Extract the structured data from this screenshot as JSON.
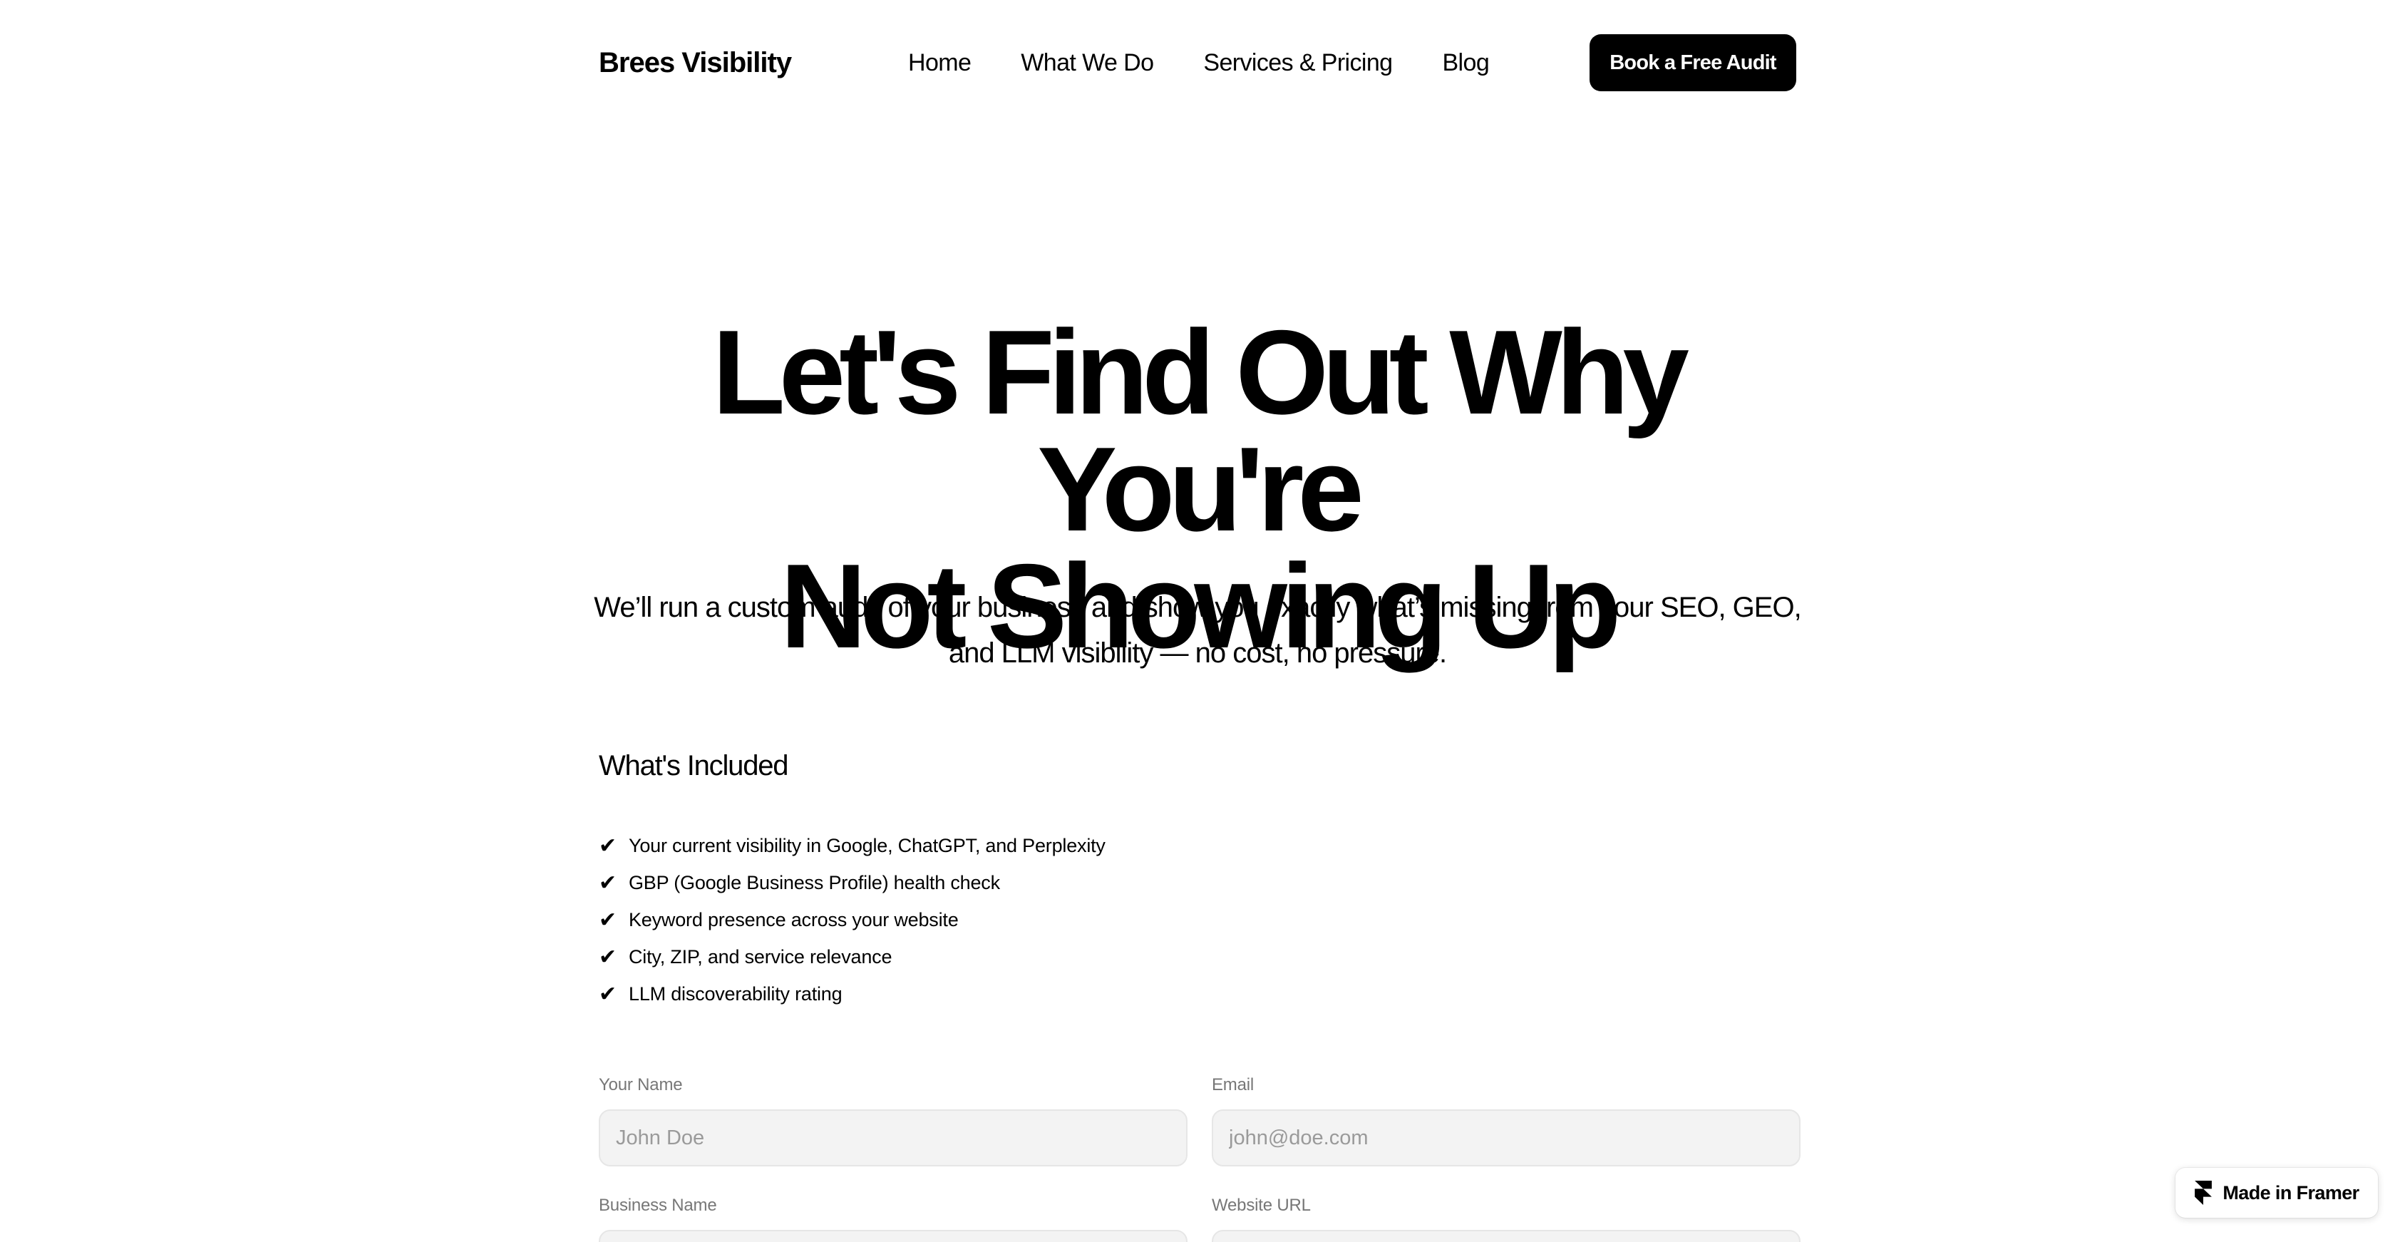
{
  "header": {
    "logo": "Brees Visibility",
    "nav": [
      "Home",
      "What We Do",
      "Services & Pricing",
      "Blog"
    ],
    "cta_label": "Book a Free Audit"
  },
  "hero": {
    "title_line1": "Let's Find Out Why You're",
    "title_line2": "Not Showing Up",
    "subtitle_line1": "We’ll run a custom audit of your business and show you exactly what’s missing from your SEO, GEO,",
    "subtitle_line2": "and LLM visibility — no cost, no pressure."
  },
  "included": {
    "heading": "What's Included",
    "check_glyph": "✔",
    "items": [
      "Your current visibility in Google, ChatGPT, and Perplexity",
      "GBP (Google Business Profile) health check",
      "Keyword presence across your website",
      "City, ZIP, and service relevance",
      "LLM discoverability rating"
    ]
  },
  "form": {
    "name_label": "Your Name",
    "name_placeholder": "John Doe",
    "email_label": "Email",
    "email_placeholder": "john@doe.com",
    "business_label": "Business Name",
    "business_placeholder": "",
    "website_label": "Website URL",
    "website_placeholder": ""
  },
  "badge": {
    "label": "Made in Framer",
    "icon": "framer-icon"
  }
}
